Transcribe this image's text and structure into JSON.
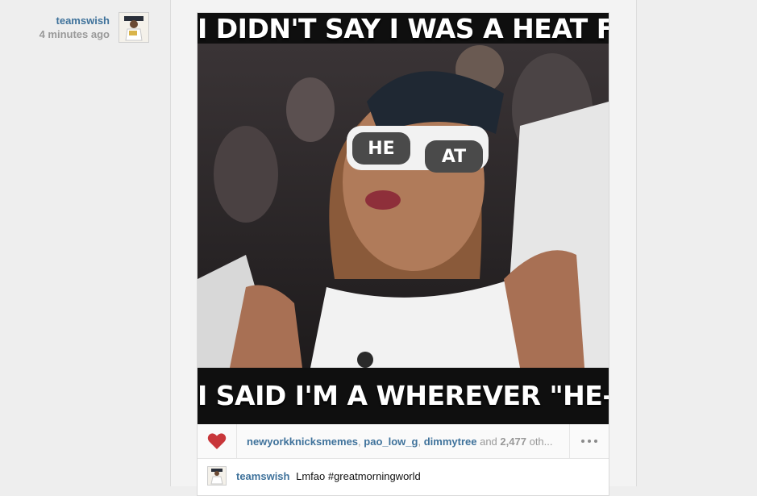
{
  "post": {
    "author": "teamswish",
    "timestamp": "4 minutes ago",
    "meme_top_text": "I DIDN'T SAY I WAS A HEAT FAN",
    "meme_bottom_text": "I SAID I'M A WHEREVER \"HE-AT\" FAN",
    "glasses_text": "HEAT"
  },
  "likes": {
    "user1": "newyorkknicksmemes",
    "sep1": ",",
    "user2": "pao_low_g",
    "sep2": ",",
    "user3": "dimmytree",
    "and": "and",
    "count": "2,477",
    "others": "oth..."
  },
  "caption": {
    "user": "teamswish",
    "text": "Lmfao #greatmorningworld"
  },
  "colors": {
    "link": "#3f729b",
    "heart": "#c8363a",
    "muted": "#999999"
  },
  "icons": {
    "like": "heart-icon",
    "more": "ellipsis-icon"
  }
}
